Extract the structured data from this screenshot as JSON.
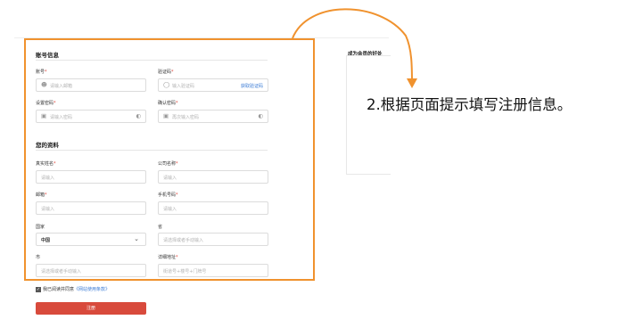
{
  "account_section": {
    "title": "账号信息",
    "account": {
      "label": "账号",
      "placeholder": "请输入邮箱"
    },
    "code": {
      "label": "验证码",
      "placeholder": "输入验证码",
      "link": "获取验证码"
    },
    "password": {
      "label": "设置密码",
      "placeholder": "请输入密码"
    },
    "confirm": {
      "label": "确认密码",
      "placeholder": "再次输入密码"
    }
  },
  "profile_section": {
    "title": "您的资料",
    "realname": {
      "label": "真实姓名",
      "placeholder": "请输入"
    },
    "company": {
      "label": "公司名称",
      "placeholder": "请输入"
    },
    "email": {
      "label": "邮箱",
      "placeholder": "请输入"
    },
    "phone": {
      "label": "手机号码",
      "placeholder": "请输入"
    },
    "country": {
      "label": "国家",
      "value": "中国"
    },
    "province": {
      "label": "省",
      "placeholder": "请选择或者手动输入"
    },
    "city": {
      "label": "市",
      "placeholder": "请选择或者手动输入"
    },
    "address": {
      "label": "详细地址",
      "placeholder": "街道号+楼号+门牌号"
    }
  },
  "required_mark": "*",
  "agreement": {
    "text": "我已阅读并同意",
    "link": "《网站使用条款》"
  },
  "register_button": "注册",
  "sidebar_title": "成为会员的好处",
  "annotation": "2.根据页面提示填写注册信息。",
  "colors": {
    "highlight": "#f0922e",
    "button": "#d84a3c",
    "link": "#3a7bd5",
    "required": "#e0453a"
  },
  "icons": [
    "user-icon",
    "shield-icon",
    "lock-icon",
    "eye-off-icon",
    "chevron-down-icon",
    "checkbox-checked-icon"
  ]
}
